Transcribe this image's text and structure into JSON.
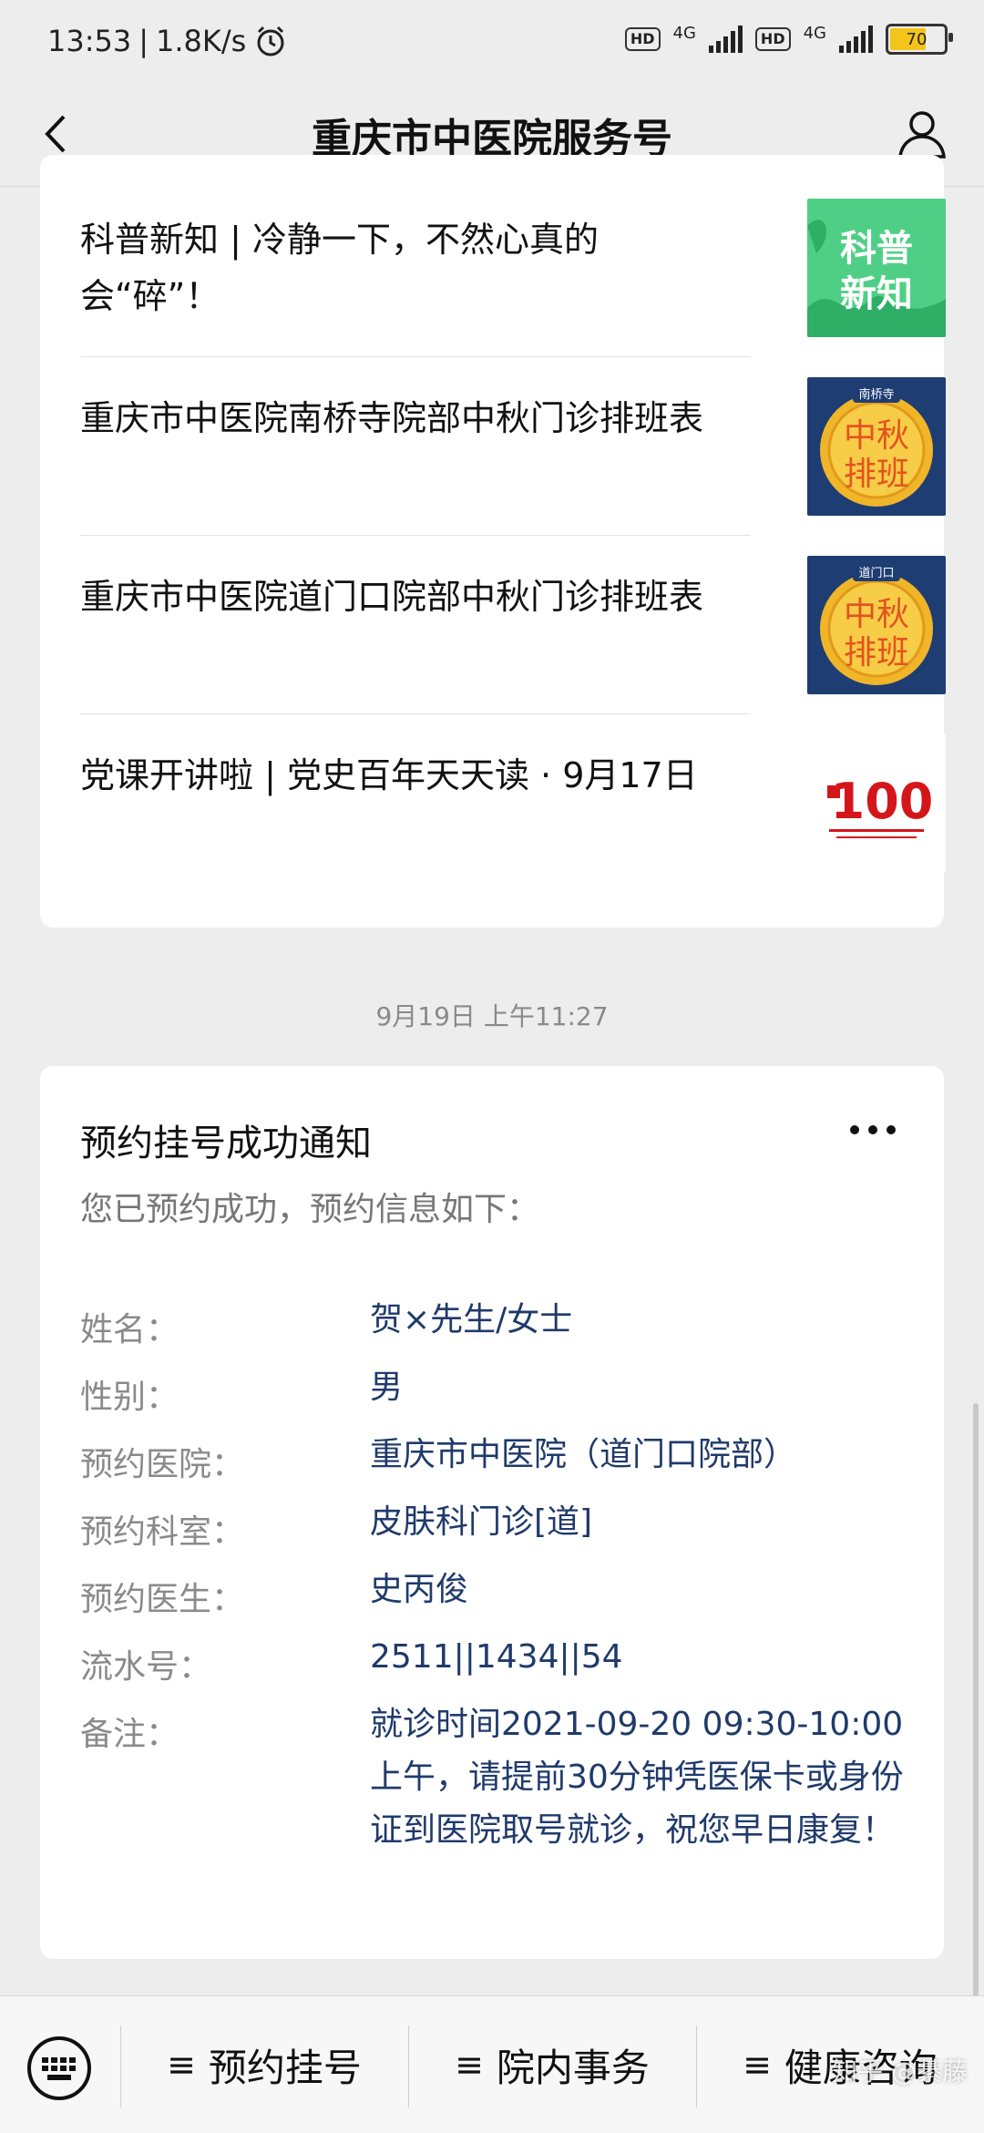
{
  "status_bar": {
    "time": "13:53",
    "net_speed": "1.8K/s",
    "sim1_label": "HD",
    "sim1_net": "4G",
    "sim2_label": "HD",
    "sim2_net": "4G",
    "battery": "70",
    "battery_level": 0.7,
    "battery_color": "#f3c419"
  },
  "nav": {
    "title": "重庆市中医院服务号",
    "back_icon": "chevron-left-icon",
    "profile_icon": "user-icon"
  },
  "articles": [
    {
      "title": "科普新知 | 冷静一下，不然心真的会“碎”！",
      "thumb_text": "科普新知",
      "thumb_color": "#3ec47a"
    },
    {
      "title": "重庆市中医院南桥寺院部中秋门诊排班表",
      "thumb_text": "中秋排班",
      "thumb_label": "南桥寺",
      "thumb_color": "#1e3d73"
    },
    {
      "title": "重庆市中医院道门口院部中秋门诊排班表",
      "thumb_text": "中秋排班",
      "thumb_label": "道门口",
      "thumb_color": "#1e3d73"
    },
    {
      "title": "党课开讲啦 | 党史百年天天读 · 9月17日",
      "thumb_text": "100",
      "thumb_color": "#d4161b"
    }
  ],
  "timestamp": "9月19日 上午11:27",
  "notice": {
    "title": "预约挂号成功通知",
    "intro": "您已预约成功，预约信息如下：",
    "fields": [
      {
        "key": "姓名：",
        "value": "贺×先生/女士"
      },
      {
        "key": "性别：",
        "value": "男"
      },
      {
        "key": "预约医院：",
        "value": "重庆市中医院（道门口院部）"
      },
      {
        "key": "预约科室：",
        "value": "皮肤科门诊[道]"
      },
      {
        "key": "预约医生：",
        "value": "史丙俊"
      },
      {
        "key": "流水号：",
        "value": "2511||1434||54"
      },
      {
        "key": "备注：",
        "value": "就诊时间2021-09-20 09:30-10:00上午，请提前30分钟凭医保卡或身份证到医院取号就诊，祝您早日康复！"
      }
    ]
  },
  "menu": {
    "keyboard_icon": "keyboard-icon",
    "items": [
      "预约挂号",
      "院内事务",
      "健康咨询"
    ]
  },
  "watermark": "知乎 @綦藤"
}
